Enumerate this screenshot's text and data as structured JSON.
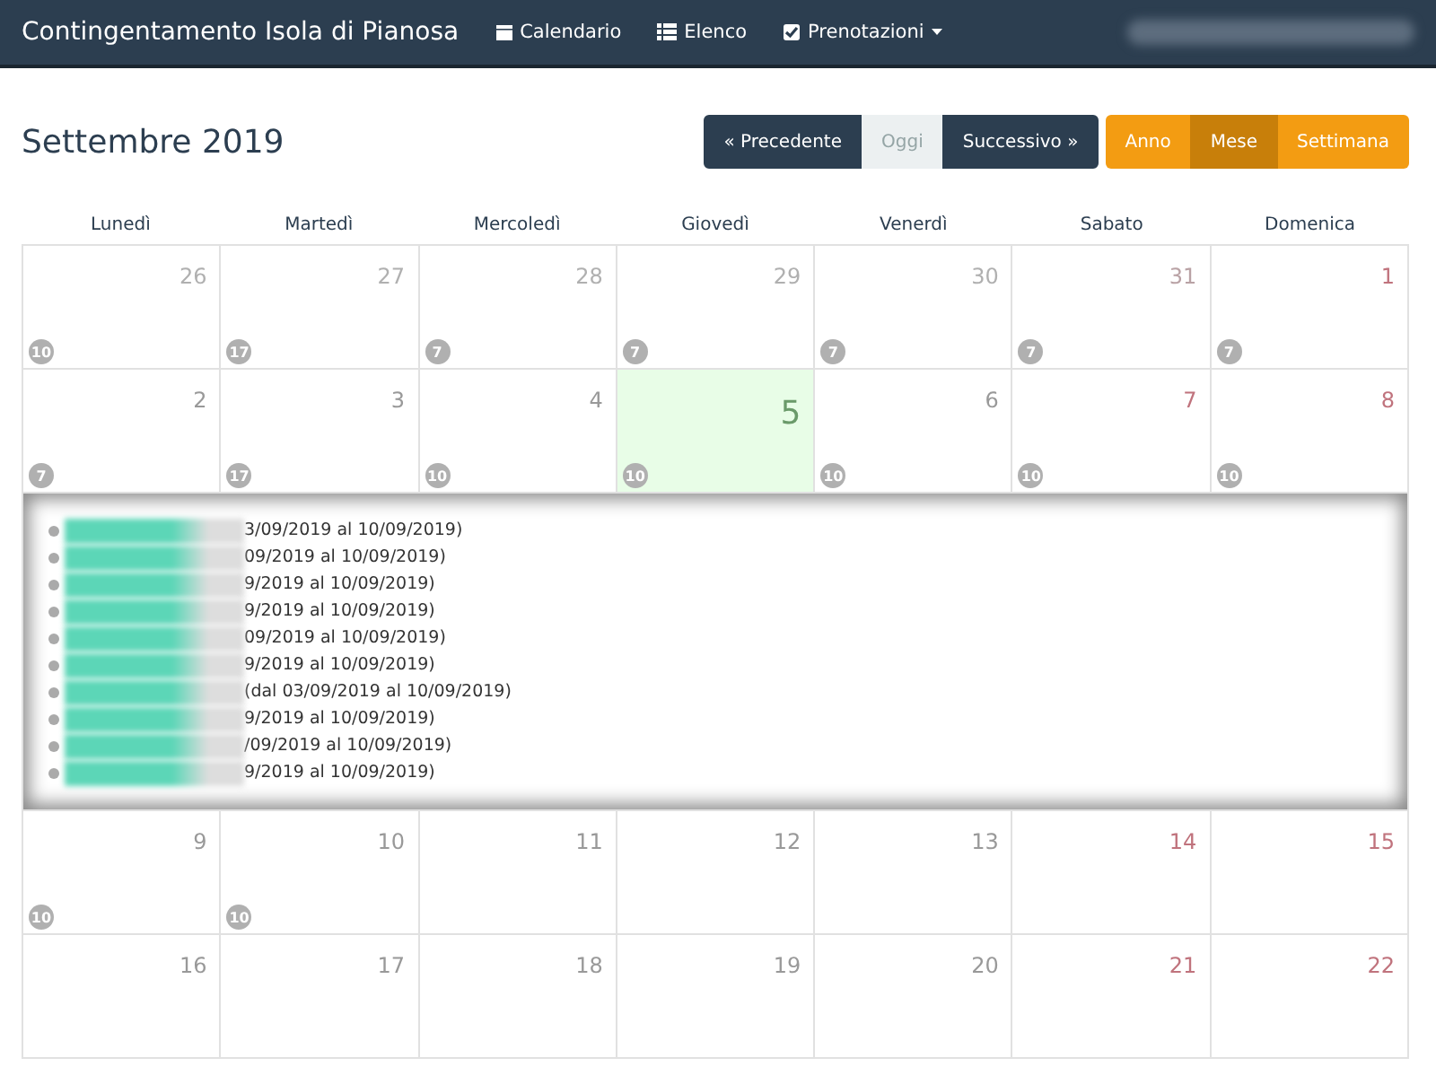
{
  "navbar": {
    "brand": "Contingentamento Isola di Pianosa",
    "links": [
      {
        "label": "Calendario",
        "dropdown": false
      },
      {
        "label": "Elenco",
        "dropdown": false
      },
      {
        "label": "Prenotazioni",
        "dropdown": true
      }
    ]
  },
  "title": "Settembre 2019",
  "nav_buttons": [
    {
      "label": "« Precedente",
      "kind": "dark"
    },
    {
      "label": "Oggi",
      "kind": "disabled"
    },
    {
      "label": "Successivo »",
      "kind": "dark"
    }
  ],
  "view_buttons": [
    {
      "label": "Anno",
      "selected": false
    },
    {
      "label": "Mese",
      "selected": true
    },
    {
      "label": "Settimana",
      "selected": false
    }
  ],
  "weekdays": [
    "Lunedì",
    "Martedì",
    "Mercoledì",
    "Giovedì",
    "Venerdì",
    "Sabato",
    "Domenica"
  ],
  "weeks": [
    {
      "days": [
        {
          "number": "26",
          "other_month": true,
          "weekend": false,
          "today": false,
          "badge": "10"
        },
        {
          "number": "27",
          "other_month": true,
          "weekend": false,
          "today": false,
          "badge": "17"
        },
        {
          "number": "28",
          "other_month": true,
          "weekend": false,
          "today": false,
          "badge": "7"
        },
        {
          "number": "29",
          "other_month": true,
          "weekend": false,
          "today": false,
          "badge": "7"
        },
        {
          "number": "30",
          "other_month": true,
          "weekend": false,
          "today": false,
          "badge": "7"
        },
        {
          "number": "31",
          "other_month": true,
          "weekend": true,
          "today": false,
          "badge": "7"
        },
        {
          "number": "1",
          "other_month": false,
          "weekend": true,
          "today": false,
          "badge": "7"
        }
      ]
    },
    {
      "days": [
        {
          "number": "2",
          "other_month": false,
          "weekend": false,
          "today": false,
          "badge": "7"
        },
        {
          "number": "3",
          "other_month": false,
          "weekend": false,
          "today": false,
          "badge": "17"
        },
        {
          "number": "4",
          "other_month": false,
          "weekend": false,
          "today": false,
          "badge": "10"
        },
        {
          "number": "5",
          "other_month": false,
          "weekend": false,
          "today": true,
          "badge": "10"
        },
        {
          "number": "6",
          "other_month": false,
          "weekend": false,
          "today": false,
          "badge": "10"
        },
        {
          "number": "7",
          "other_month": false,
          "weekend": true,
          "today": false,
          "badge": "10"
        },
        {
          "number": "8",
          "other_month": false,
          "weekend": true,
          "today": false,
          "badge": "10"
        }
      ],
      "events": [
        {
          "text": "3/09/2019 al 10/09/2019)"
        },
        {
          "text": "09/2019 al 10/09/2019)"
        },
        {
          "text": "9/2019 al 10/09/2019)"
        },
        {
          "text": "9/2019 al 10/09/2019)"
        },
        {
          "text": "09/2019 al 10/09/2019)"
        },
        {
          "text": "9/2019 al 10/09/2019)"
        },
        {
          "text": "(dal 03/09/2019 al 10/09/2019)"
        },
        {
          "text": "9/2019 al 10/09/2019)"
        },
        {
          "text": "/09/2019 al 10/09/2019)"
        },
        {
          "text": "9/2019 al 10/09/2019)"
        }
      ]
    },
    {
      "days": [
        {
          "number": "9",
          "other_month": false,
          "weekend": false,
          "today": false,
          "badge": "10"
        },
        {
          "number": "10",
          "other_month": false,
          "weekend": false,
          "today": false,
          "badge": "10"
        },
        {
          "number": "11",
          "other_month": false,
          "weekend": false,
          "today": false
        },
        {
          "number": "12",
          "other_month": false,
          "weekend": false,
          "today": false
        },
        {
          "number": "13",
          "other_month": false,
          "weekend": false,
          "today": false
        },
        {
          "number": "14",
          "other_month": false,
          "weekend": true,
          "today": false
        },
        {
          "number": "15",
          "other_month": false,
          "weekend": true,
          "today": false
        }
      ]
    },
    {
      "days": [
        {
          "number": "16",
          "other_month": false,
          "weekend": false,
          "today": false
        },
        {
          "number": "17",
          "other_month": false,
          "weekend": false,
          "today": false
        },
        {
          "number": "18",
          "other_month": false,
          "weekend": false,
          "today": false
        },
        {
          "number": "19",
          "other_month": false,
          "weekend": false,
          "today": false
        },
        {
          "number": "20",
          "other_month": false,
          "weekend": false,
          "today": false
        },
        {
          "number": "21",
          "other_month": false,
          "weekend": true,
          "today": false
        },
        {
          "number": "22",
          "other_month": false,
          "weekend": true,
          "today": false
        }
      ]
    }
  ]
}
